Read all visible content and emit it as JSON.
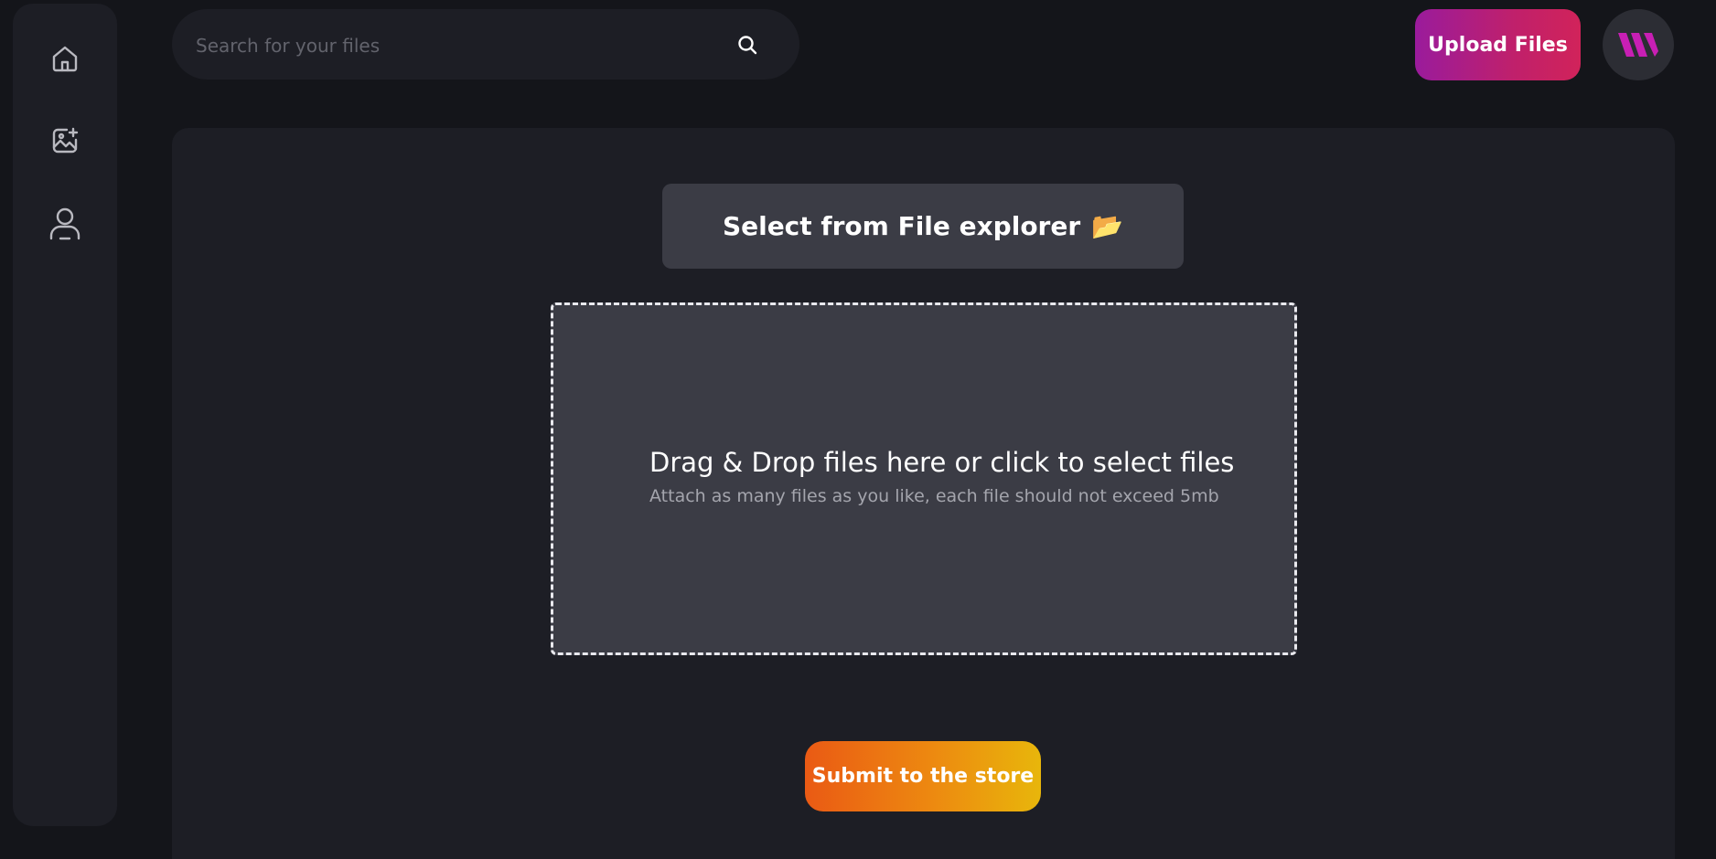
{
  "sidebar": {
    "items": [
      {
        "name": "home",
        "icon": "home-icon"
      },
      {
        "name": "images",
        "icon": "image-add-icon"
      },
      {
        "name": "profile",
        "icon": "user-icon"
      }
    ]
  },
  "search": {
    "placeholder": "Search for your files",
    "value": "",
    "icon": "search-icon"
  },
  "header": {
    "upload_label": "Upload Files",
    "avatar_icon": "brand-logo-icon"
  },
  "main": {
    "select_label": "Select from File explorer",
    "select_emoji": "📂",
    "dropzone": {
      "title": "Drag & Drop files here or click to select files",
      "subtitle": "Attach as many files as you like, each file should not exceed 5mb"
    },
    "submit_label": "Submit to the store"
  },
  "colors": {
    "background": "#14151a",
    "panel": "#1d1e25",
    "surface": "#3b3c45",
    "upload_gradient_start": "#9a1b9c",
    "upload_gradient_end": "#d1235a",
    "submit_gradient_start": "#ea5a14",
    "submit_gradient_end": "#e8b60b",
    "logo": "#c81fb4"
  }
}
